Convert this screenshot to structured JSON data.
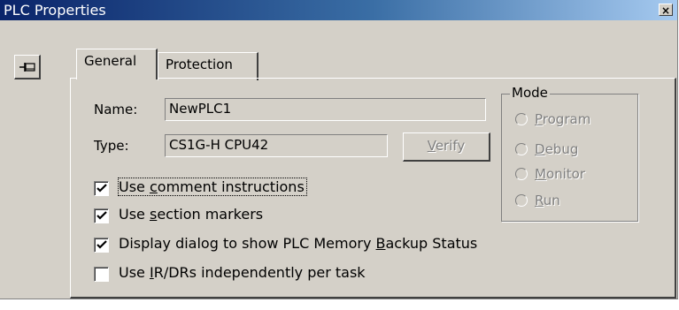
{
  "window": {
    "title": "PLC Properties",
    "close_glyph": "×"
  },
  "pin_button": {
    "icon": "pin-icon"
  },
  "tabs": [
    {
      "label": "General",
      "active": true
    },
    {
      "label": "Protection",
      "active": false
    }
  ],
  "general": {
    "name_label": "Name:",
    "name_value": "NewPLC1",
    "type_label": "Type:",
    "type_value": "CS1G-H  CPU42",
    "verify_label": "Verify"
  },
  "mode": {
    "legend": "Mode",
    "options": [
      "Program",
      "Debug",
      "Monitor",
      "Run"
    ]
  },
  "checkboxes": [
    {
      "label": "Use comment instructions",
      "checked": true
    },
    {
      "label": "Use section markers",
      "checked": true
    },
    {
      "label": "Display dialog to show PLC Memory Backup Status",
      "checked": true
    },
    {
      "label": "Use IR/DRs independently per task",
      "checked": false
    }
  ]
}
